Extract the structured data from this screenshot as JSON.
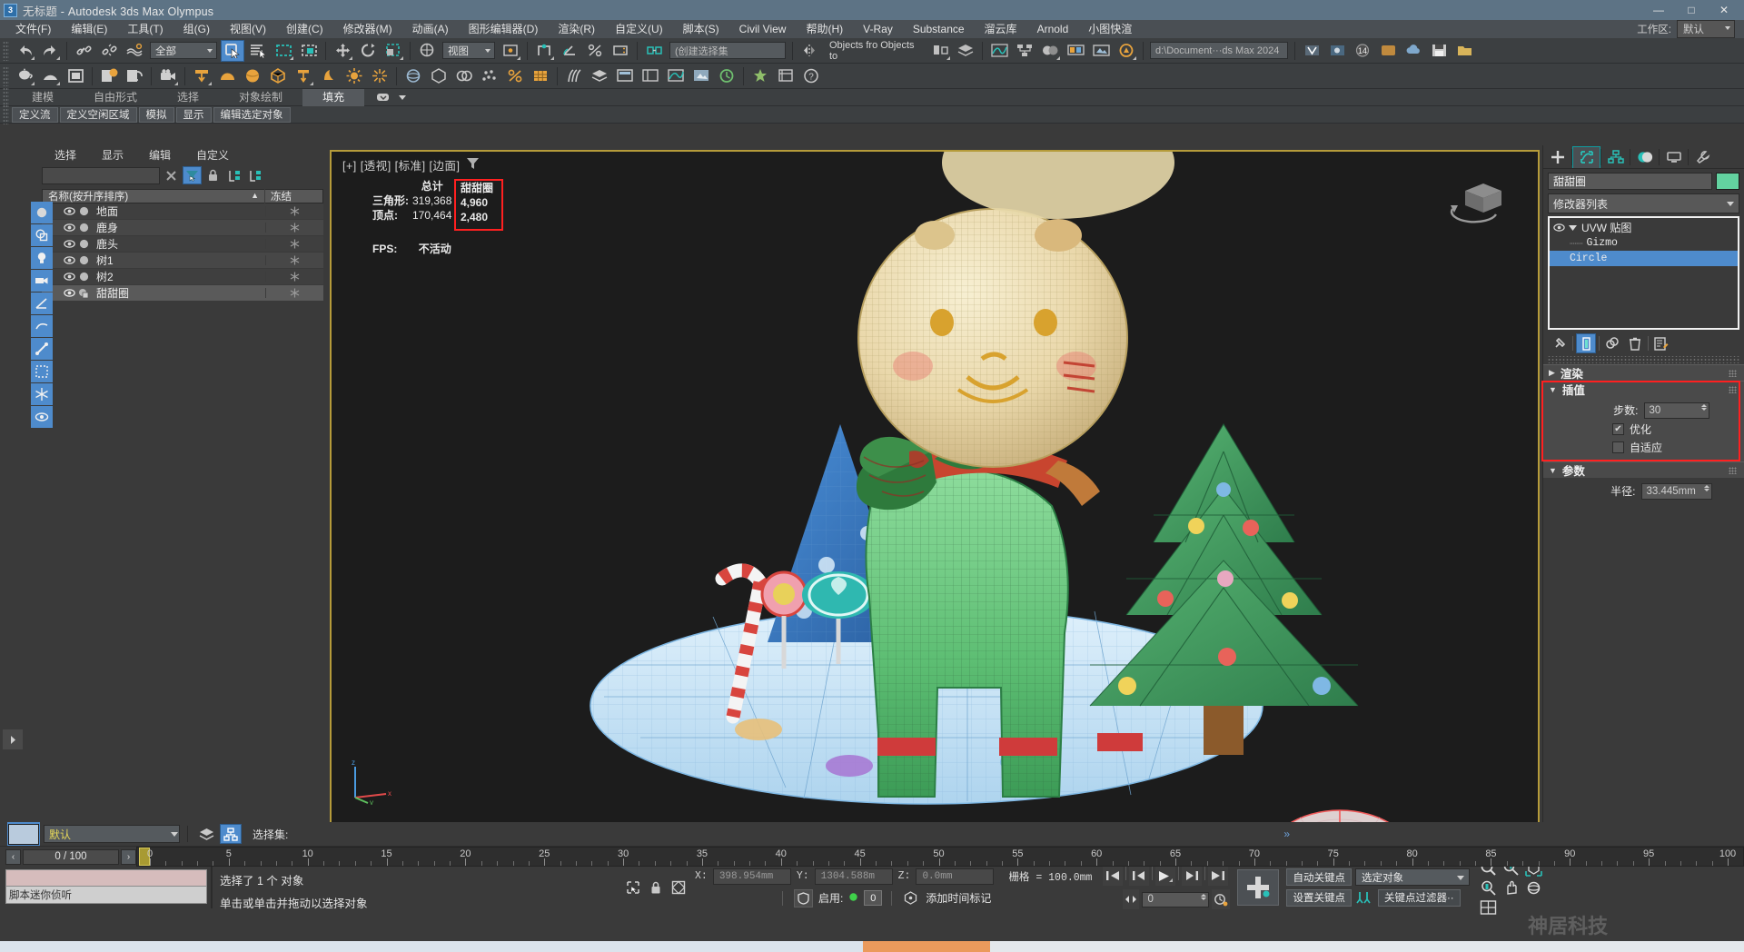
{
  "titlebar": {
    "file": "无标题",
    "app": " - Autodesk 3ds Max Olympus",
    "icon": "3ds-max-icon",
    "minimize": "—",
    "maximize": "□",
    "close": "✕"
  },
  "menu": {
    "items": [
      "文件(F)",
      "编辑(E)",
      "工具(T)",
      "组(G)",
      "视图(V)",
      "创建(C)",
      "修改器(M)",
      "动画(A)",
      "图形编辑器(D)",
      "渲染(R)",
      "自定义(U)",
      "脚本(S)",
      "Civil View",
      "帮助(H)",
      "V-Ray",
      "Substance",
      "溜云库",
      "Arnold",
      "小图快渲"
    ],
    "workspace_label": "工作区:",
    "workspace_value": "默认"
  },
  "toolbar": {
    "selection_filter": "全部",
    "named_selection_placeholder": "(创建选择集",
    "snaps_label": "Objects fro Objects to",
    "path_field": "d:\\Document···ds Max 2024",
    "render_badge": "14"
  },
  "ribbon": {
    "tabs": [
      "建模",
      "自由形式",
      "选择",
      "对象绘制",
      "填充"
    ],
    "active_tab": "填充",
    "buttons": [
      "定义流",
      "定义空闲区域",
      "模拟",
      "显示",
      "编辑选定对象"
    ]
  },
  "explorer": {
    "menu": [
      "选择",
      "显示",
      "编辑",
      "自定义"
    ],
    "search_value": "",
    "columns": {
      "name": "名称(按升序排序)",
      "sort": "▲",
      "frozen": "冻结"
    },
    "rows": [
      {
        "name": "地面",
        "visible": true,
        "selected": false
      },
      {
        "name": "鹿身",
        "visible": true,
        "selected": false
      },
      {
        "name": "鹿头",
        "visible": true,
        "selected": false
      },
      {
        "name": "树1",
        "visible": true,
        "selected": false
      },
      {
        "name": "树2",
        "visible": true,
        "selected": false
      },
      {
        "name": "甜甜圈",
        "visible": true,
        "selected": true
      }
    ]
  },
  "viewport": {
    "label": "[+] [透视] [标准] [边面]",
    "stats": {
      "total_header": "总计",
      "object_header": "甜甜圈",
      "tri_label": "三角形:",
      "tri_total": "319,368",
      "tri_object": "4,960",
      "vert_label": "顶点:",
      "vert_total": "170,464",
      "vert_object": "2,480",
      "fps_label": "FPS:",
      "fps_value": "不活动"
    }
  },
  "command_panel": {
    "tabs": [
      "create-tab",
      "modify-tab",
      "hierarchy-tab",
      "motion-tab",
      "display-tab",
      "utilities-tab"
    ],
    "active_tab_index": 1,
    "object_name": "甜甜圈",
    "object_color": "#63d2a0",
    "modifier_list_label": "修改器列表",
    "stack": [
      {
        "label": "UVW 贴图",
        "type": "modifier",
        "selected": false,
        "eye": true,
        "expanded": true
      },
      {
        "label": "Gizmo",
        "type": "subobject",
        "selected": false
      },
      {
        "label": "Circle",
        "type": "base",
        "selected": true
      }
    ],
    "rollouts": [
      {
        "title": "渲染",
        "open": false,
        "highlight": false
      },
      {
        "title": "插值",
        "open": true,
        "highlight": true,
        "fields": [
          {
            "kind": "spinner",
            "label": "步数:",
            "value": "30"
          },
          {
            "kind": "checkbox",
            "label": "优化",
            "checked": true
          },
          {
            "kind": "checkbox",
            "label": "自适应",
            "checked": false
          }
        ]
      },
      {
        "title": "参数",
        "open": true,
        "highlight": false,
        "fields": [
          {
            "kind": "spinner",
            "label": "半径:",
            "value": "33.445mm"
          }
        ]
      }
    ]
  },
  "bottom": {
    "layer_name": "默认",
    "selection_set_label": "选择集:",
    "frame_current": "0 / 100",
    "timeline": {
      "min": 0,
      "max": 100,
      "labels": [
        0,
        5,
        10,
        15,
        20,
        25,
        30,
        35,
        40,
        45,
        50,
        55,
        60,
        65,
        70,
        75,
        80,
        85,
        90,
        95,
        100
      ],
      "playhead": 0
    },
    "mini_listener": "脚本迷你侦听",
    "status_line_1": "选择了 1 个 对象",
    "status_line_2": "单击或单击并拖动以选择对象",
    "coords": {
      "x_label": "X:",
      "x_value": "398.954mm",
      "y_label": "Y:",
      "y_value": "1304.588m",
      "z_label": "Z:",
      "z_value": "0.0mm",
      "grid": "栅格 = 100.0mm"
    },
    "keys": {
      "enable_label": "启用:",
      "enable_value": "0",
      "add_time_tag": "添加时间标记",
      "auto_key": "自动关键点",
      "set_key": "设置关键点",
      "key_filters": "关键点过滤器··",
      "selection_target": "选定对象",
      "spinner_value": "0"
    }
  }
}
